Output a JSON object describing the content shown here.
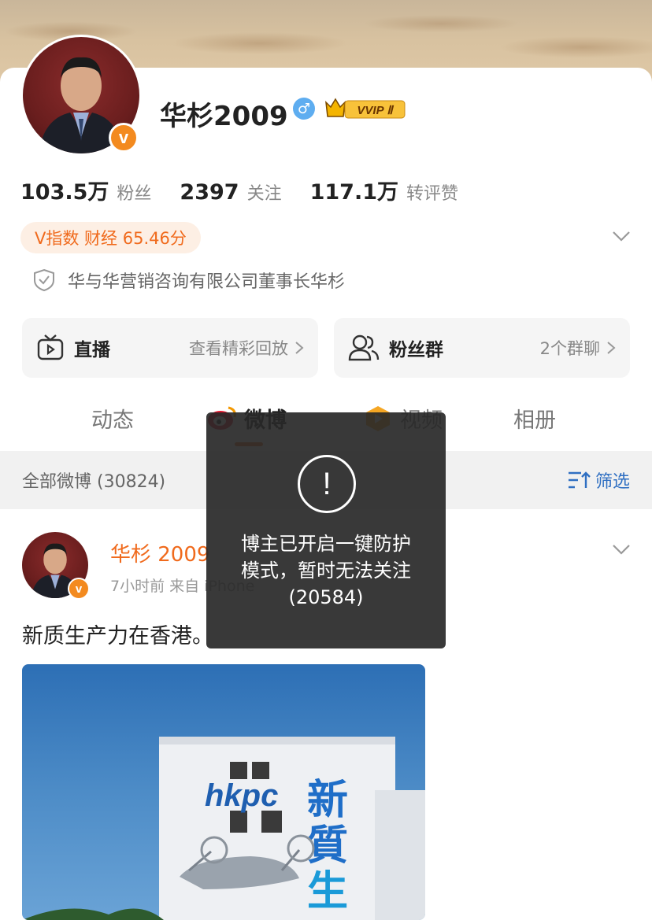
{
  "profile": {
    "name": "华杉2009",
    "gender_symbol": "♂",
    "vvip_label": "VVIP Ⅱ",
    "verified_badge": "v",
    "stats": [
      {
        "value": "103.5万",
        "label": "粉丝"
      },
      {
        "value": "2397",
        "label": "关注"
      },
      {
        "value": "117.1万",
        "label": "转评赞"
      }
    ],
    "v_index": "V指数 财经 65.46分",
    "verification": "华与华营销咨询有限公司董事长华杉"
  },
  "actions": {
    "live": {
      "title": "直播",
      "sub": "查看精彩回放",
      "icon": "tv-icon"
    },
    "fans": {
      "title": "粉丝群",
      "sub": "2个群聊",
      "icon": "group-icon"
    }
  },
  "tabs": [
    {
      "label": "动态"
    },
    {
      "label": "微博"
    },
    {
      "label": "视频"
    },
    {
      "label": "相册"
    }
  ],
  "filter": {
    "count": "全部微博 (30824)",
    "button": "筛选"
  },
  "post": {
    "author": "华杉 2009",
    "meta": "7小时前  来自 iPhone",
    "text": "新质生产力在香港。",
    "image_brand": "hkpc",
    "image_sign": "新\n質\n生"
  },
  "toast": {
    "icon": "!",
    "message": "博主已开启一键防护\n模式，暂时无法关注\n(20584)"
  },
  "colors": {
    "accent": "#f06a1c",
    "link": "#2f6fc2",
    "vbadge": "#f38a1f"
  }
}
